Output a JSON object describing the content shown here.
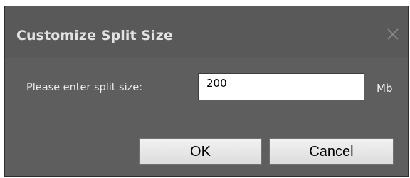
{
  "dialog": {
    "title": "Customize Split Size",
    "close_icon": "close-icon",
    "prompt_label": "Please enter split size:",
    "split_size_value": "200",
    "unit_label": "Mb",
    "ok_label": "OK",
    "cancel_label": "Cancel"
  },
  "colors": {
    "background": "#5e5e5e",
    "title_text": "#e2e2e2",
    "button_face": "#e6e6e6"
  }
}
